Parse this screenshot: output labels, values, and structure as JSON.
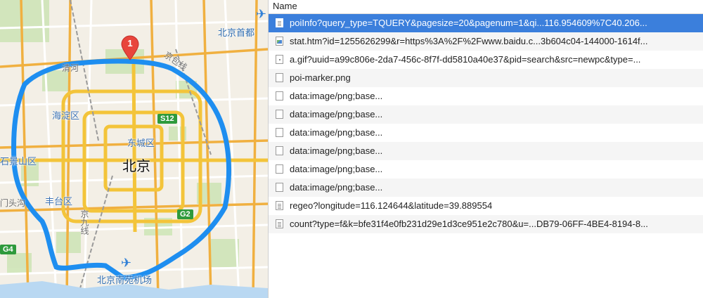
{
  "map": {
    "city_label": "北京",
    "districts": [
      "海淀区",
      "东城区",
      "石景山区",
      "丰台区"
    ],
    "partial_labels": {
      "qinghe": "清河",
      "jingbao": "京包线",
      "jingjiu": "京九线",
      "mentougou": "门头沟"
    },
    "airports": {
      "capital": "北京首都",
      "nanyuan": "北京南苑机场"
    },
    "shields": {
      "s12": "S12",
      "g2": "G2",
      "g4": "G4"
    },
    "marker_number": "1",
    "colors": {
      "ring_road": "#1e8ef0",
      "arterial": "#f3c43a",
      "marker": "#e8453c"
    }
  },
  "network": {
    "column_header": "Name",
    "rows": [
      {
        "name": "poiInfo?query_type=TQUERY&pagesize=20&pagenum=1&qi...116.954609%7C40.206...",
        "icon": "doc-icon",
        "selected": true
      },
      {
        "name": "stat.htm?id=1255626299&r=https%3A%2F%2Fwww.baidu.c...3b604c04-144000-1614f...",
        "icon": "image-icon",
        "selected": false
      },
      {
        "name": "a.gif?uuid=a99c806e-2da7-456c-8f7f-dd5810a40e37&pid=search&src=newpc&type=...",
        "icon": "gif-icon",
        "selected": false
      },
      {
        "name": "poi-marker.png",
        "icon": "image-placeholder-icon",
        "selected": false
      },
      {
        "name": "data:image/png;base...",
        "icon": "image-placeholder-icon",
        "selected": false
      },
      {
        "name": "data:image/png;base...",
        "icon": "image-placeholder-icon",
        "selected": false
      },
      {
        "name": "data:image/png;base...",
        "icon": "image-placeholder-icon",
        "selected": false
      },
      {
        "name": "data:image/png;base...",
        "icon": "image-placeholder-icon",
        "selected": false
      },
      {
        "name": "data:image/png;base...",
        "icon": "image-placeholder-icon",
        "selected": false
      },
      {
        "name": "data:image/png;base...",
        "icon": "image-placeholder-icon",
        "selected": false
      },
      {
        "name": "regeo?longitude=116.124644&latitude=39.889554",
        "icon": "doc-icon",
        "selected": false
      },
      {
        "name": "count?type=f&k=bfe31f4e0fb231d29e1d3ce951e2c780&u=...DB79-06FF-4BE4-8194-8...",
        "icon": "doc-icon",
        "selected": false
      }
    ]
  }
}
